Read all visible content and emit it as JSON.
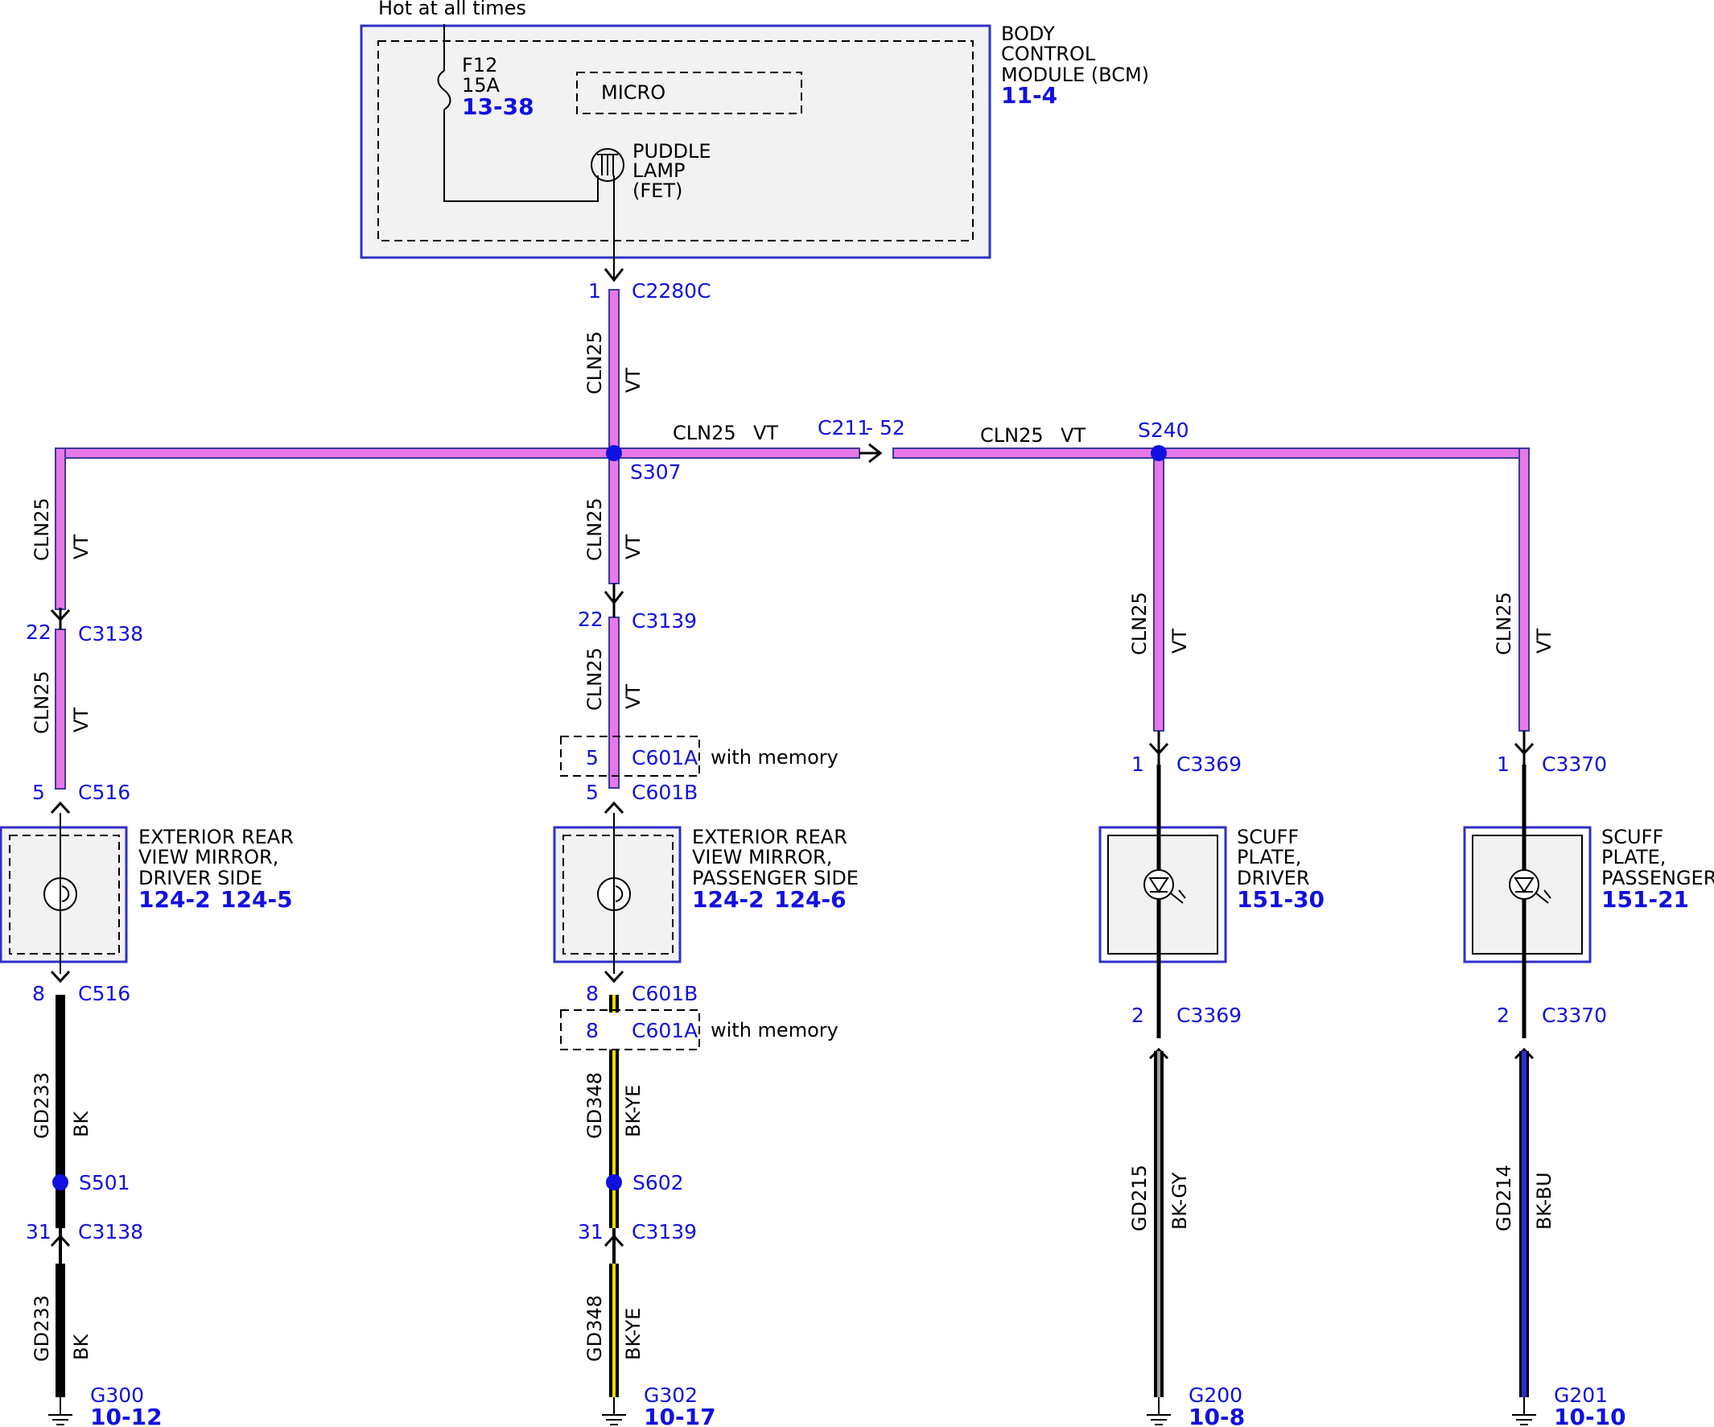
{
  "colors": {
    "vt": "#e878e8",
    "vt_edge": "#3a3a9a",
    "bk": "#000000",
    "bk_ye_stripe": "#e8e000",
    "bk_gy_stripe": "#a0a0a0",
    "bk_bu_stripe": "#2c2cd0",
    "connector_text": "#1010e0",
    "splice": "#1010e0",
    "component_border": "#3030c8",
    "component_fill": "#f2f2f2"
  },
  "power": {
    "label": "Hot at all times"
  },
  "bcm": {
    "title": [
      "BODY",
      "CONTROL",
      "MODULE (BCM)"
    ],
    "ref": "11-4",
    "fuse": {
      "name": "F12",
      "rating": "15A",
      "ref": "13-38"
    },
    "micro_label": "MICRO",
    "fet_label": [
      "PUDDLE",
      "LAMP",
      "(FET)"
    ]
  },
  "wires": {
    "circuit": "CLN25",
    "vt": "VT",
    "gd233": "GD233",
    "bk": "BK",
    "gd348": "GD348",
    "bk_ye": "BK-YE",
    "gd215": "GD215",
    "bk_gy": "BK-GY",
    "gd214": "GD214",
    "bk_bu": "BK-BU"
  },
  "connectors": {
    "c2280c": {
      "pin": "1",
      "name": "C2280C"
    },
    "c211": {
      "name": "C211",
      "pin": "- 52"
    },
    "s307": "S307",
    "s240": "S240",
    "c3138_top": {
      "pin": "22",
      "name": "C3138"
    },
    "c516_top": {
      "pin": "5",
      "name": "C516"
    },
    "c3139_top": {
      "pin": "22",
      "name": "C3139"
    },
    "c601a_top": {
      "pin": "5",
      "name": "C601A",
      "note": "with memory"
    },
    "c601b_top": {
      "pin": "5",
      "name": "C601B"
    },
    "c3369_top": {
      "pin": "1",
      "name": "C3369"
    },
    "c3370_top": {
      "pin": "1",
      "name": "C3370"
    },
    "c516_bot": {
      "pin": "8",
      "name": "C516"
    },
    "c601b_bot": {
      "pin": "8",
      "name": "C601B"
    },
    "c601a_bot": {
      "pin": "8",
      "name": "C601A",
      "note": "with memory"
    },
    "c3369_bot": {
      "pin": "2",
      "name": "C3369"
    },
    "c3370_bot": {
      "pin": "2",
      "name": "C3370"
    },
    "s501": "S501",
    "s602": "S602",
    "c3138_bot": {
      "pin": "31",
      "name": "C3138"
    },
    "c3139_bot": {
      "pin": "31",
      "name": "C3139"
    }
  },
  "components": {
    "mirror_driver": {
      "lines": [
        "EXTERIOR REAR",
        "VIEW MIRROR,",
        "DRIVER SIDE"
      ],
      "ref1": "124-2",
      "ref2": "124-5"
    },
    "mirror_passenger": {
      "lines": [
        "EXTERIOR REAR",
        "VIEW MIRROR,",
        "PASSENGER SIDE"
      ],
      "ref1": "124-2",
      "ref2": "124-6"
    },
    "scuff_driver": {
      "lines": [
        "SCUFF",
        "PLATE,",
        "DRIVER"
      ],
      "ref": "151-30"
    },
    "scuff_passenger": {
      "lines": [
        "SCUFF",
        "PLATE,",
        "PASSENGER"
      ],
      "ref": "151-21"
    }
  },
  "grounds": {
    "g300": {
      "name": "G300",
      "ref": "10-12"
    },
    "g302": {
      "name": "G302",
      "ref": "10-17"
    },
    "g200": {
      "name": "G200",
      "ref": "10-8"
    },
    "g201": {
      "name": "G201",
      "ref": "10-10"
    }
  }
}
